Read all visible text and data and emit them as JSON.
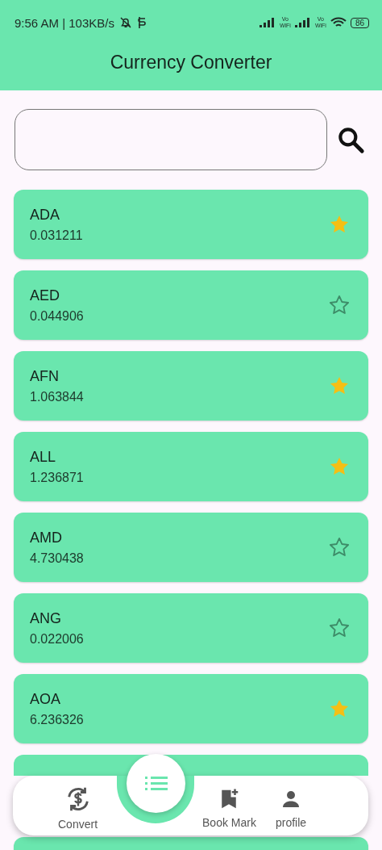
{
  "status_bar": {
    "time": "9:56 AM | 103KB/s",
    "battery": "86",
    "network_labels": [
      {
        "top": "Vo",
        "bottom": "WiFi"
      },
      {
        "top": "Vo",
        "bottom": "WiFi"
      }
    ]
  },
  "app_bar": {
    "title": "Currency Converter"
  },
  "search": {
    "kind": "field"
  },
  "currencies": [
    {
      "code": "ADA",
      "rate": "0.031211",
      "favorite": true
    },
    {
      "code": "AED",
      "rate": "0.044906",
      "favorite": false
    },
    {
      "code": "AFN",
      "rate": "1.063844",
      "favorite": true
    },
    {
      "code": "ALL",
      "rate": "1.236871",
      "favorite": true
    },
    {
      "code": "AMD",
      "rate": "4.730438",
      "favorite": false
    },
    {
      "code": "ANG",
      "rate": "0.022006",
      "favorite": false
    },
    {
      "code": "AOA",
      "rate": "6.236326",
      "favorite": true
    }
  ],
  "bottom_nav": [
    {
      "kind": "convert",
      "label": "Convert",
      "selected": false
    },
    {
      "kind": "list",
      "selected": true
    },
    {
      "kind": "bookmark",
      "label": "Book Mark",
      "selected": false
    },
    {
      "kind": "profile",
      "label": "profile",
      "selected": false
    }
  ]
}
